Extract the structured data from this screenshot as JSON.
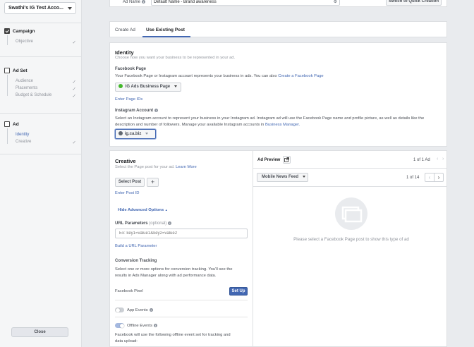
{
  "sidebar": {
    "account_name": "Swathi's IG Test Acco...",
    "campaign": {
      "title": "Campaign",
      "items": [
        "Objective"
      ]
    },
    "adset": {
      "title": "Ad Set",
      "items": [
        "Audience",
        "Placements",
        "Budget & Schedule"
      ]
    },
    "ad": {
      "title": "Ad",
      "items": [
        "Identity",
        "Creative"
      ]
    },
    "close_label": "Close"
  },
  "adname": {
    "label": "Ad Name",
    "value": "Default Name - Brand awareness",
    "switch_label": "Switch to Quick Creation"
  },
  "tabs": [
    "Create Ad",
    "Use Existing Post"
  ],
  "identity": {
    "title": "Identity",
    "subtitle": "Choose how you want your business to be represented in your ad.",
    "fb_page_label": "Facebook Page",
    "fb_page_desc": "Your Facebook Page or Instagram account represents your business in ads. You can also",
    "fb_page_link": "Create a Facebook Page",
    "fb_page_value": "IG Ads Business Page",
    "enter_page_ids": "Enter Page IDs",
    "ig_label": "Instagram Account",
    "ig_desc": "Select an Instagram account to represent your business in your Instagram ad. Instagram ad will use the Facebook Page name and profile picture, as well as details like the description and number of followers. Manage your available Instagram accounts in",
    "ig_link": "Business Manager.",
    "ig_value": "ig.ca.biz"
  },
  "creative": {
    "title": "Creative",
    "subtitle": "Select the Page post for your ad.",
    "learn_more": "Learn More",
    "select_post": "Select Post",
    "plus": "+",
    "enter_post_id": "Enter Post ID",
    "hide_advanced": "Hide Advanced Options",
    "url_params_label": "URL Parameters",
    "url_params_optional": "(optional)",
    "url_params_placeholder": "Ex: key1=value1&key2=value2",
    "build_url": "Build a URL Parameter",
    "conv_title": "Conversion Tracking",
    "conv_desc_1": "Select one or more options for conversion tracking. You'll see the",
    "conv_desc_2": "results in Ads Manager along with ad performance data.",
    "fb_pixel": "Facebook Pixel",
    "setup": "Set Up",
    "app_events": "App Events",
    "offline_events": "Offline Events",
    "offline_desc_1": "Facebook will use the following offline event set for tracking and",
    "offline_desc_2": "data upload:"
  },
  "preview": {
    "title": "Ad Preview",
    "ad_count": "1 of 1 Ad",
    "placement": "Mobile News Feed",
    "page_count": "1 of 14",
    "empty_msg": "Please select a Facebook Page post to show this type of ad"
  },
  "colors": {
    "accent": "#4267b2",
    "background": "#e9ebee"
  }
}
